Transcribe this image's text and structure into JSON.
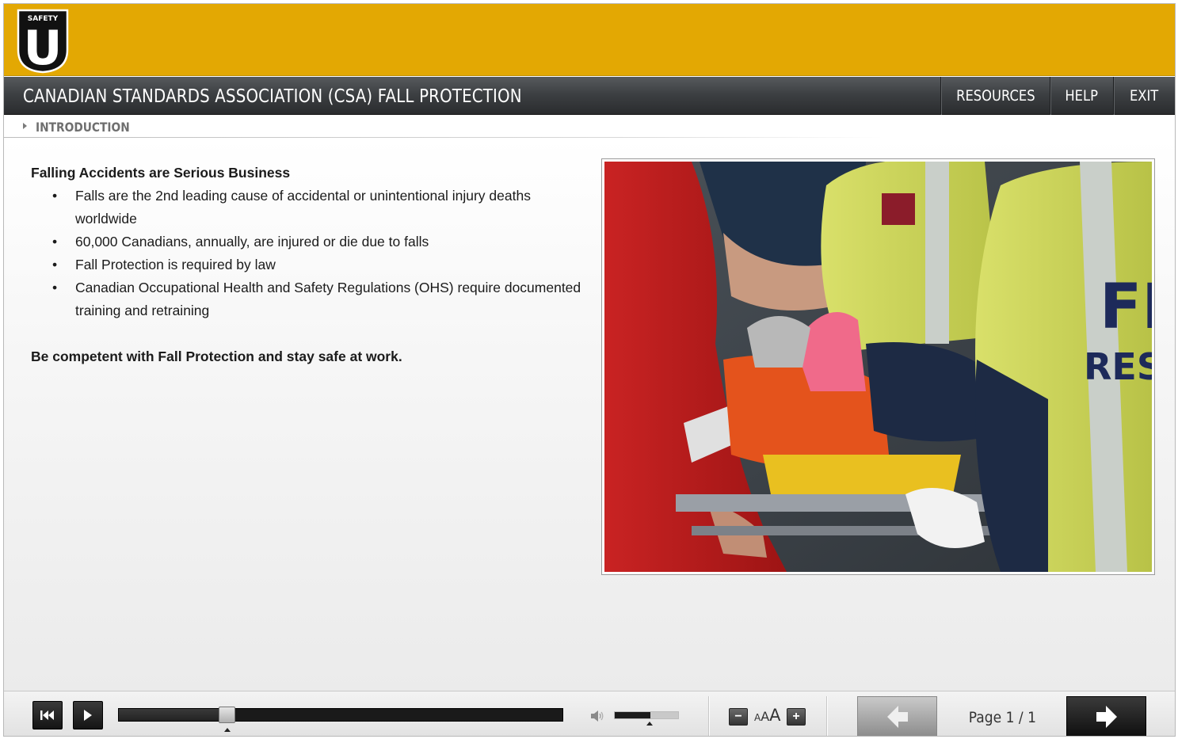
{
  "header": {
    "logo_top_text": "SAFETY",
    "logo_letter": "U"
  },
  "titlebar": {
    "course_title": "CANADIAN STANDARDS ASSOCIATION (CSA) FALL PROTECTION",
    "buttons": {
      "resources": "RESOURCES",
      "help": "HELP",
      "exit": "EXIT"
    }
  },
  "breadcrumb": {
    "section": "INTRODUCTION"
  },
  "slide": {
    "heading": "Falling Accidents are Serious Business",
    "bullets": [
      "Falls are the 2nd leading cause of accidental or unintentional injury deaths worldwide",
      "60,000 Canadians, annually, are injured or die due to falls",
      "Fall Protection is required by law",
      "Canadian Occupational Health and Safety Regulations (OHS) require documented training and retraining"
    ],
    "closing": "Be competent with Fall Protection and stay safe at work.",
    "photo_jacket_text_1": "FI",
    "photo_jacket_text_2": "RES"
  },
  "controls": {
    "progress_fraction": 0.245,
    "volume_fraction": 0.55,
    "font_minus": "−",
    "font_plus": "+",
    "font_label": [
      "A",
      "A",
      "A"
    ],
    "page_label": "Page 1 / 1"
  },
  "colors": {
    "header_yellow": "#e3a803",
    "titlebar_dark": "#3d4043"
  }
}
